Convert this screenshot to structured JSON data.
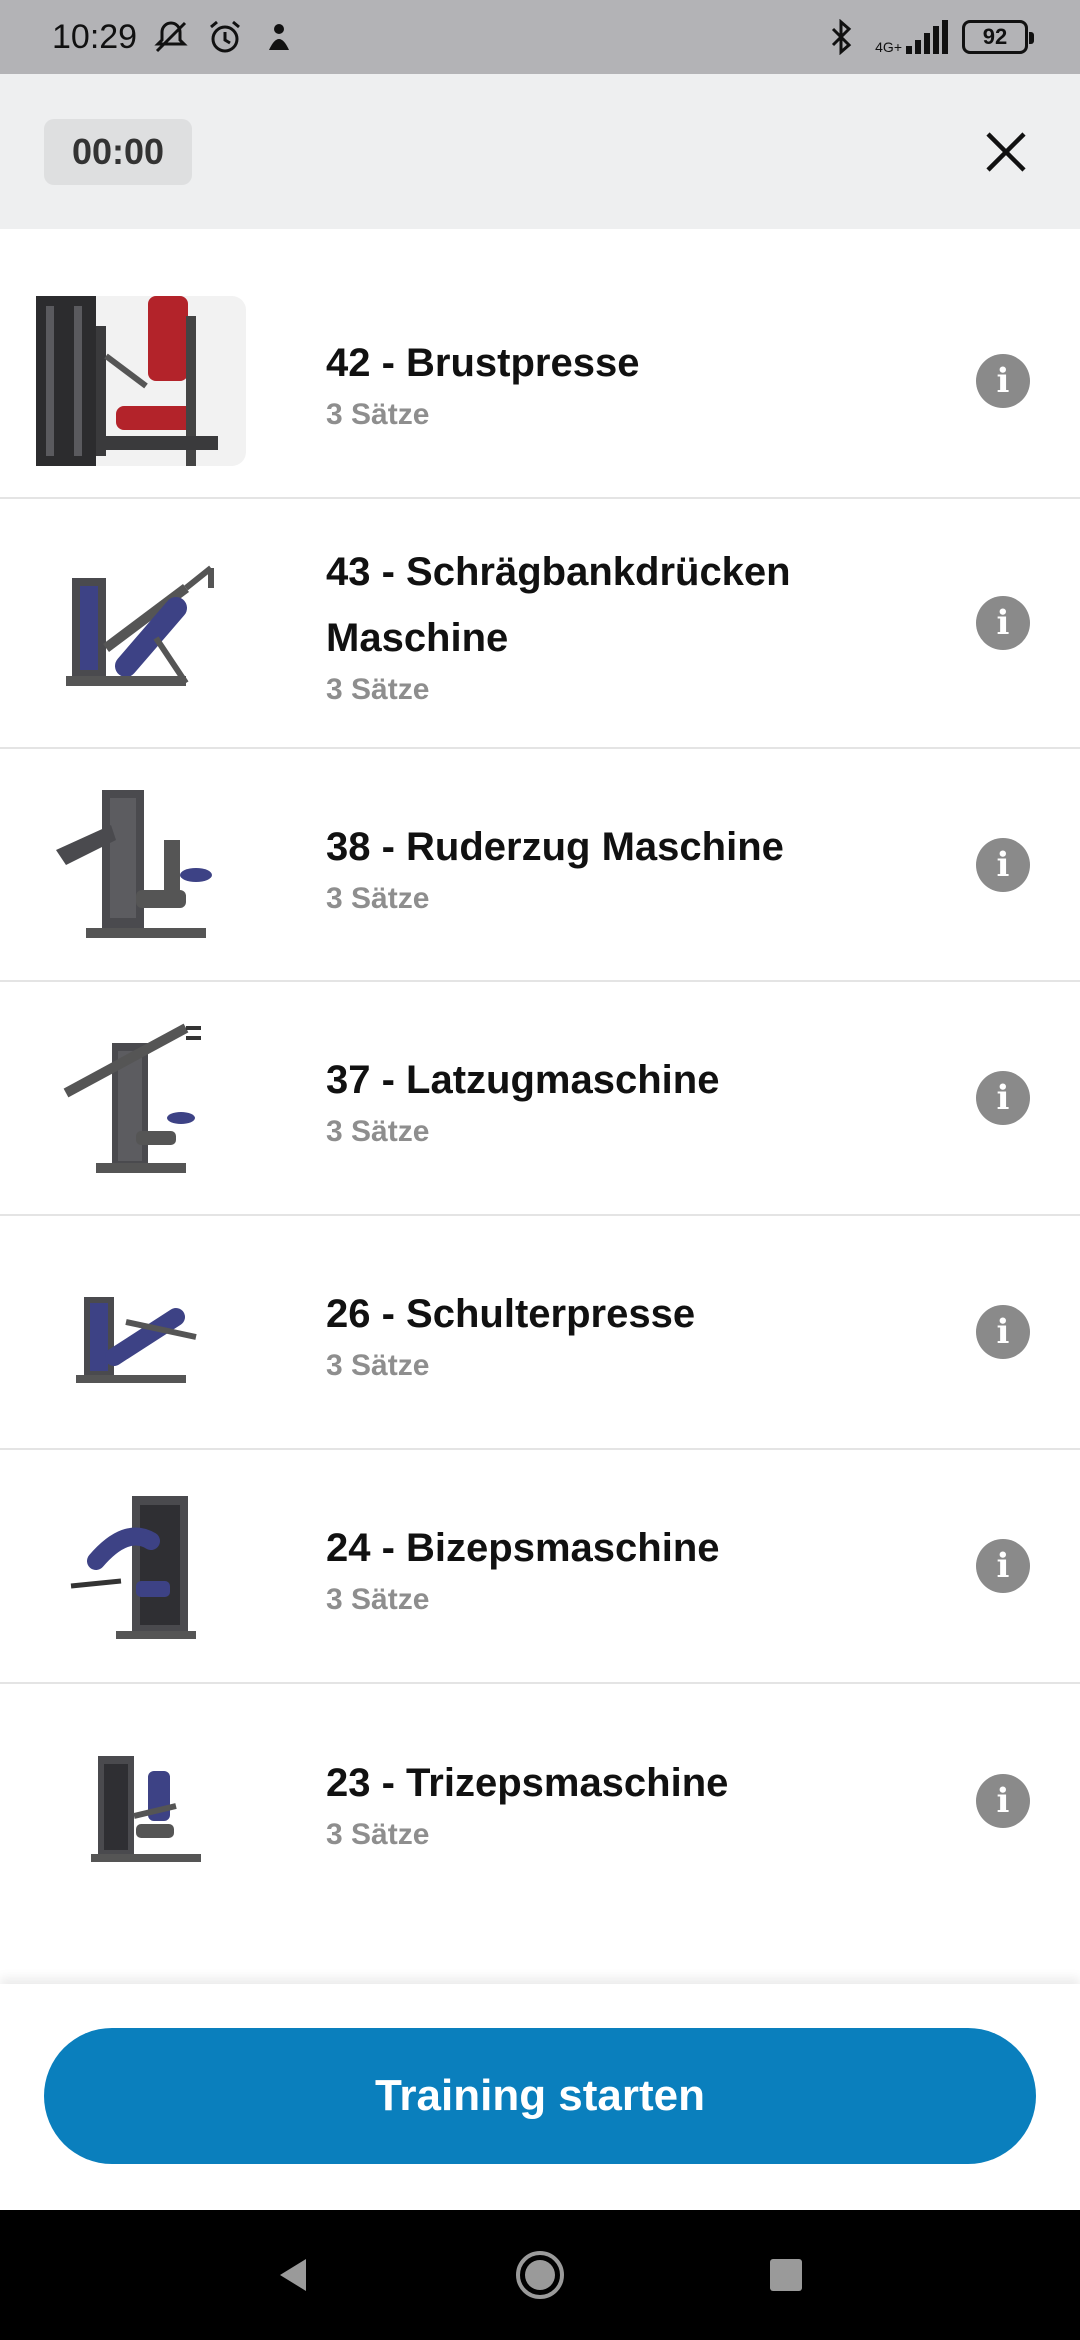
{
  "status_bar": {
    "time": "10:29",
    "network_label_top": "4G+",
    "battery_level": "92",
    "icons": [
      "mute-icon",
      "alarm-icon",
      "notification-icon",
      "bluetooth-icon",
      "signal-icon",
      "battery-icon"
    ]
  },
  "header": {
    "timer": "00:00",
    "close_icon": "close-icon"
  },
  "exercises": [
    {
      "title": "42 - Brustpresse",
      "sets": "3 Sätze",
      "image": "chest-press-machine",
      "accent": "#b3232a"
    },
    {
      "title": "43 - Schrägbankdrücken Maschine",
      "sets": "3 Sätze",
      "image": "incline-press-machine",
      "accent": "#3d4285"
    },
    {
      "title": "38 - Ruderzug Maschine",
      "sets": "3 Sätze",
      "image": "row-machine",
      "accent": "#3d4285"
    },
    {
      "title": "37 - Latzugmaschine",
      "sets": "3 Sätze",
      "image": "lat-pulldown-machine",
      "accent": "#3d4285"
    },
    {
      "title": "26 - Schulterpresse",
      "sets": "3 Sätze",
      "image": "shoulder-press-machine",
      "accent": "#3d4285"
    },
    {
      "title": "24 - Bizepsmaschine",
      "sets": "3 Sätze",
      "image": "biceps-machine",
      "accent": "#3d4285"
    },
    {
      "title": "23 - Trizepsmaschine",
      "sets": "3 Sätze",
      "image": "triceps-machine",
      "accent": "#3d4285"
    }
  ],
  "info_icon": "info-icon",
  "footer": {
    "start_button": "Training starten",
    "start_button_color": "#0a7fbd"
  },
  "nav_bar": {
    "icons": [
      "back-icon",
      "home-icon",
      "recents-icon"
    ]
  }
}
